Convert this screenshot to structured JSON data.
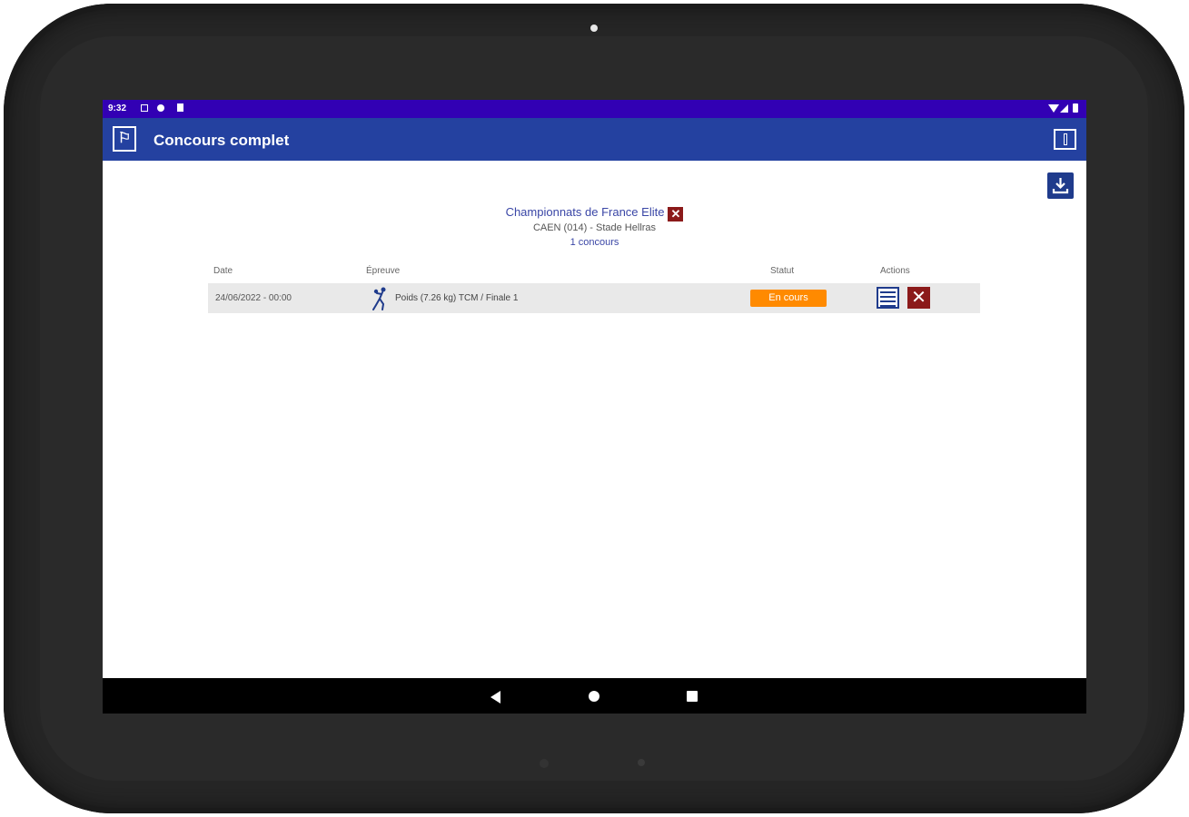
{
  "statusbar": {
    "time": "9:32"
  },
  "appbar": {
    "title": "Concours complet"
  },
  "competition": {
    "name": "Championnats de France Elite",
    "place": "CAEN (014) - Stade Hellras",
    "count": "1 concours"
  },
  "table": {
    "headers": [
      "Date",
      "Épreuve",
      "Statut",
      "Actions"
    ],
    "rows": [
      {
        "date": "24/06/2022 - 00:00",
        "event": "Poids (7.26 kg) TCM / Finale 1",
        "status": "En cours"
      }
    ]
  },
  "icons": {
    "app_logo": "athletics-logo-icon",
    "info": "info-icon",
    "download": "download-icon",
    "remove_competition": "close-icon",
    "event": "shot-put-icon",
    "open": "table-icon",
    "delete": "close-icon"
  },
  "colors": {
    "statusbar": "#3200b4",
    "appbar": "#2441a0",
    "status_in_progress": "#ff8a00",
    "danger": "#8b1a1a",
    "primary": "#1f3b8c"
  }
}
